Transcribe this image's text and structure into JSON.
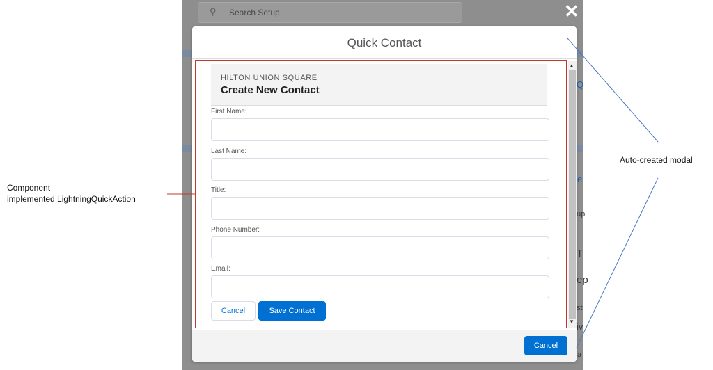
{
  "annotations": {
    "left_line1": "Component",
    "left_line2": "implemented  LightningQuickAction",
    "right": "Auto-created modal"
  },
  "background": {
    "search_placeholder": "Search Setup",
    "fragments": [
      "Q",
      "e",
      "up",
      "T",
      "ep",
      "st",
      "iv",
      "a"
    ]
  },
  "modal": {
    "title": "Quick Contact",
    "footer_cancel": "Cancel"
  },
  "component": {
    "account_name": "HILTON UNION SQUARE",
    "title": "Create New Contact",
    "fields": [
      {
        "label": "First Name:",
        "value": ""
      },
      {
        "label": "Last Name:",
        "value": ""
      },
      {
        "label": "Title:",
        "value": ""
      },
      {
        "label": "Phone Number:",
        "value": ""
      },
      {
        "label": "Email:",
        "value": ""
      }
    ],
    "cancel_label": "Cancel",
    "save_label": "Save Contact"
  },
  "colors": {
    "brand_blue": "#0070d2",
    "frame_red": "#c0392b",
    "annotation_line_blue": "#4a78c0"
  }
}
